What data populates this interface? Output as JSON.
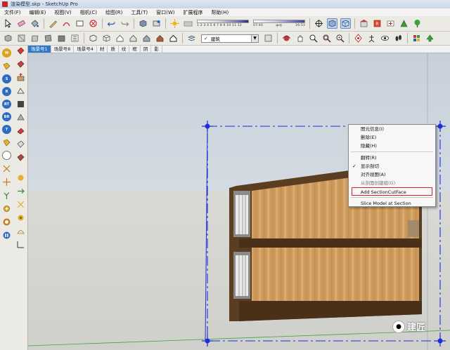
{
  "window": {
    "title": "渲染模型.skp - SketchUp Pro"
  },
  "menu": [
    "文件(F)",
    "编辑(E)",
    "视图(V)",
    "相机(C)",
    "绘图(R)",
    "工具(T)",
    "窗口(W)",
    "扩展程序",
    "帮助(H)"
  ],
  "shadow_time": {
    "months": "1 2 3 4 5 6 7 8 9 10 11 12",
    "start": "07:40",
    "noon": "中午",
    "end": "16:53"
  },
  "layer": {
    "value": "建筑"
  },
  "scene_tabs": [
    "场景号1",
    "场景号8",
    "场景号4",
    "材",
    "质",
    "纹",
    "框",
    "阴",
    "影"
  ],
  "context_menu": {
    "items": [
      "图元信息(I)",
      "删除(E)",
      "隐藏(H)",
      "翻转(R)",
      "显示剖切",
      "对齐视图(A)",
      "从剖面创建组(G)",
      "Add SectionCutFace",
      "Slice Model at Section"
    ]
  },
  "left_badges": [
    "M",
    "S",
    "R",
    "RT",
    "BR",
    "T"
  ],
  "watermark": {
    "text": "建匠"
  },
  "colors": {
    "section_blue": "#1e2fd6",
    "highlight_red": "#d2232a",
    "tab_active": "#2f78c6",
    "wood": "#d4a86a"
  }
}
